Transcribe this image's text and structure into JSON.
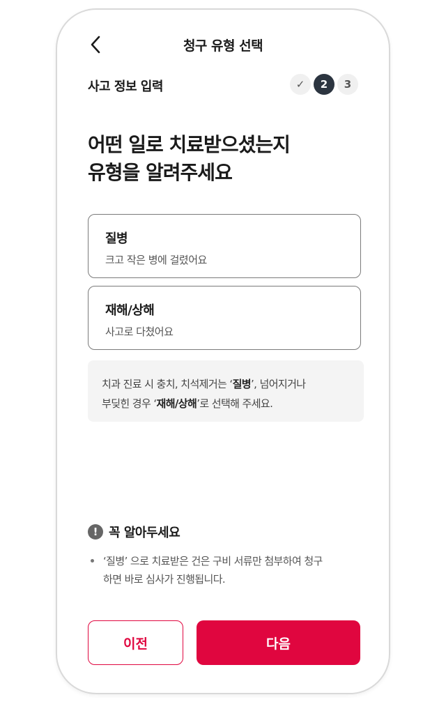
{
  "header": {
    "title": "청구 유형 선택",
    "back_icon": "chevron-left-icon"
  },
  "progress": {
    "section_label": "사고 정보 입력",
    "steps": [
      {
        "label": "✓",
        "state": "completed"
      },
      {
        "label": "2",
        "state": "active"
      },
      {
        "label": "3",
        "state": "upcoming"
      }
    ]
  },
  "headline": {
    "line1": "어떤 일로 치료받으셨는지",
    "line2": "유형을 알려주세요"
  },
  "options": [
    {
      "title": "질병",
      "subtitle": "크고 작은 병에 걸렸어요"
    },
    {
      "title": "재해/상해",
      "subtitle": "사고로 다쳤어요"
    }
  ],
  "info": {
    "p1": "치과 진료 시 충치, 치석제거는 ‘",
    "b1": "질병",
    "p2": "’, 넘어지거나",
    "p3": "부딪힌 경우 ‘",
    "b2": "재해/상해",
    "p4": "’로 선택해 주세요."
  },
  "notice": {
    "icon": "exclamation-icon",
    "title": "꼭 알아두세요",
    "items": [
      {
        "line1": "‘질병’ 으로 치료받은 건은 구비 서류만 첨부하여 청구",
        "line2": "하면 바로 심사가 진행됩니다."
      }
    ]
  },
  "buttons": {
    "prev": "이전",
    "next": "다음"
  },
  "colors": {
    "primary": "#e0063f",
    "step_active": "#2c3540",
    "info_bg": "#f4f4f4"
  }
}
